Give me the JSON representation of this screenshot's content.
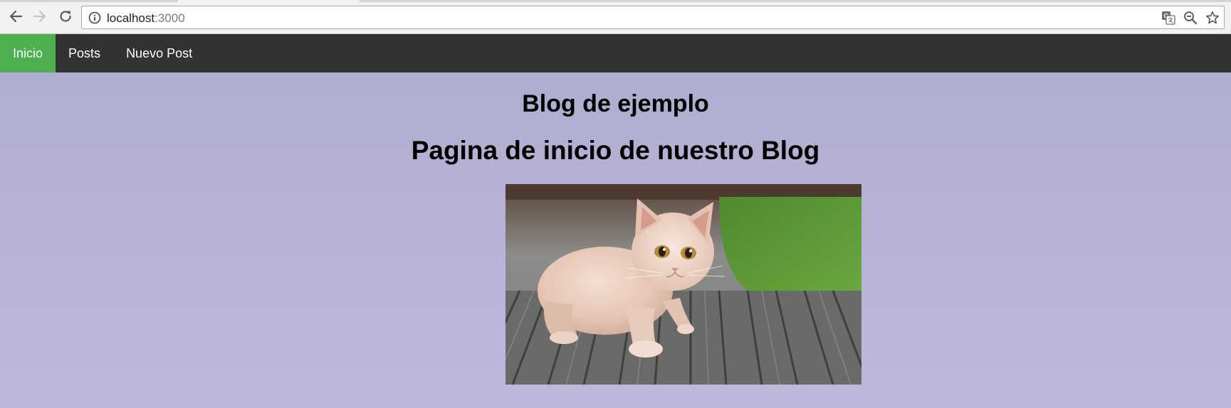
{
  "browser": {
    "url_host": "localhost",
    "url_port": ":3000",
    "icons": {
      "back": "back-arrow-icon",
      "forward": "forward-arrow-icon",
      "reload": "reload-icon",
      "info": "info-icon",
      "translate": "translate-icon",
      "zoom": "zoom-out-icon",
      "bookmark": "star-icon"
    }
  },
  "nav": {
    "items": [
      {
        "label": "Inicio",
        "active": true
      },
      {
        "label": "Posts",
        "active": false
      },
      {
        "label": "Nuevo Post",
        "active": false
      }
    ],
    "active_color": "#4caf50",
    "bar_color": "#333333"
  },
  "main": {
    "title": "Blog de ejemplo",
    "subtitle": "Pagina de inicio de nuestro Blog",
    "image": "kitten on wooden deck photo"
  }
}
